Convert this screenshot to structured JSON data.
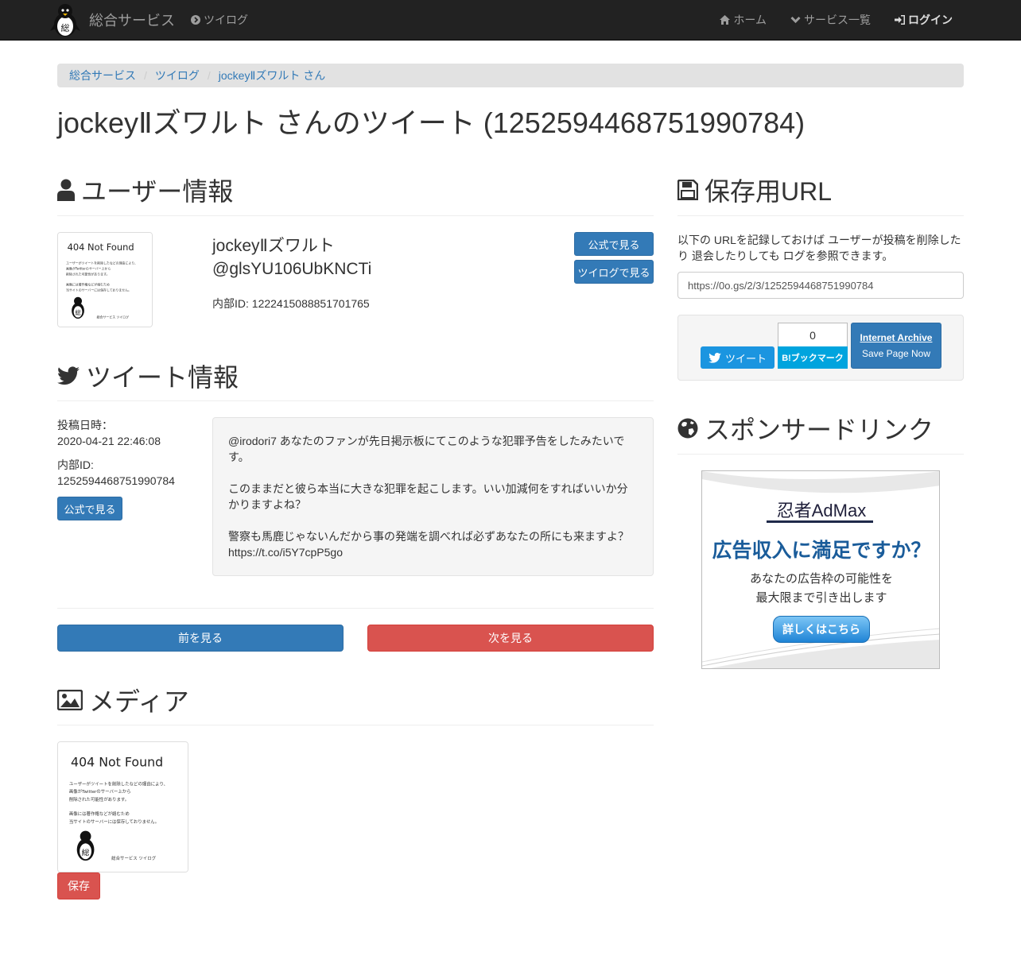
{
  "navbar": {
    "brand": "総合サービス",
    "left_item": "ツイログ",
    "home": "ホーム",
    "services": "サービス一覧",
    "login": "ログイン"
  },
  "breadcrumb": [
    "総合サービス",
    "ツイログ",
    "jockeyⅡズワルト さん"
  ],
  "page_title": "jockeyⅡズワルト さんのツイート (1252594468751990784)",
  "user_section": {
    "title": "ユーザー情報",
    "name": "jockeyⅡズワルト",
    "handle": "@glsYU106UbKNCTi",
    "internal_id": "内部ID: 1222415088851701765",
    "btn_official": "公式で見る",
    "btn_twilog": "ツイログで見る"
  },
  "not_found_image": {
    "title": "404 Not Found",
    "line1": "ユーザーがツイートを削除したなどの理由により、",
    "line2": "画像がTwitterのサーバー上から",
    "line3": "削除された可能性があります。",
    "line4": "画像には著作権などが絡むため",
    "line5": "当サイトのサーバーには保存しておりません。",
    "footer": "総合サービス ツイログ",
    "mascot_char": "総"
  },
  "tweet_section": {
    "title": "ツイート情報",
    "posted_label": "投稿日時：",
    "posted_value": "2020-04-21 22:46:08",
    "id_label": "内部ID:",
    "id_value": "1252594468751990784",
    "btn_official": "公式で見る",
    "text": [
      "@irodori7 あなたのファンが先日掲示板にてこのような犯罪予告をしたみたいです。",
      "このままだと彼ら本当に大きな犯罪を起こします。いい加減何をすればいいか分かりますよね？",
      "警察も馬鹿じゃないんだから事の発端を調べれば必ずあなたの所にも来ますよ？ https://t.co/i5Y7cpP5go"
    ]
  },
  "pager": {
    "prev": "前を見る",
    "next": "次を見る"
  },
  "media_section": {
    "title": "メディア",
    "save": "保存"
  },
  "save_section": {
    "title": "保存用URL",
    "description": "以下の URLを記録しておけば ユーザーが投稿を削除したり 退会したりしても ログを参照できます。",
    "url": "https://0o.gs/2/3/1252594468751990784",
    "tweet_btn": "ツイート",
    "hatena_count": "0",
    "hatena_btn": "B!ブックマーク",
    "ia_title": "Internet Archive",
    "ia_sub": "Save Page Now"
  },
  "sponsor_section": {
    "title": "スポンサードリンク",
    "ad_logo": "忍者AdMax",
    "ad_headline": "広告収入に満足ですか？",
    "ad_sub1": "あなたの広告枠の可能性を",
    "ad_sub2": "最大限まで引き出します",
    "ad_button": "詳しくはこちら"
  },
  "colors": {
    "primary": "#337ab7",
    "danger": "#d9534f",
    "navbar": "#222222",
    "twitter": "#1b95e0",
    "hatena": "#00a4de"
  }
}
